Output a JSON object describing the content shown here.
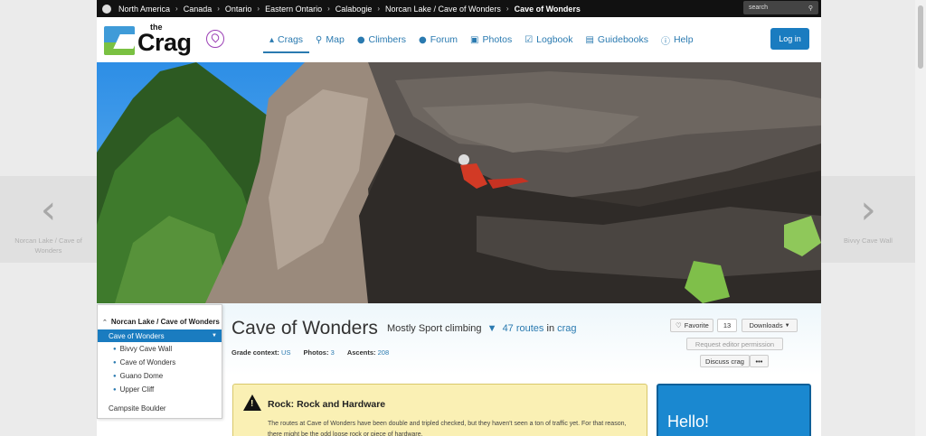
{
  "breadcrumb": {
    "items": [
      "North America",
      "Canada",
      "Ontario",
      "Eastern Ontario",
      "Calabogie",
      "Norcan Lake / Cave of Wonders"
    ],
    "current": "Cave of Wonders",
    "search_placeholder": "search"
  },
  "logo": {
    "small": "the",
    "name": "Crag"
  },
  "nav": {
    "items": [
      {
        "label": "Crags",
        "icon": "crags-icon"
      },
      {
        "label": "Map",
        "icon": "map-icon"
      },
      {
        "label": "Climbers",
        "icon": "climber-icon"
      },
      {
        "label": "Forum",
        "icon": "forum-icon"
      },
      {
        "label": "Photos",
        "icon": "camera-icon"
      },
      {
        "label": "Logbook",
        "icon": "logbook-icon"
      },
      {
        "label": "Guidebooks",
        "icon": "book-icon"
      },
      {
        "label": "Help",
        "icon": "info-icon"
      }
    ],
    "login_label": "Log in"
  },
  "side": {
    "prev_label": "Norcan Lake / Cave of Wonders",
    "next_label": "Bivvy Cave Wall"
  },
  "tree": {
    "parent": "Norcan Lake / Cave of Wonders",
    "current": "Cave of Wonders",
    "children": [
      "Bivvy Cave Wall",
      "Cave of Wonders",
      "Guano Dome",
      "Upper Cliff"
    ],
    "other": "Campsite Boulder"
  },
  "crag": {
    "title": "Cave of Wonders",
    "subtitle_type": "Mostly Sport climbing",
    "routes_link": "47 routes",
    "routes_suffix": "in",
    "crag_link": "crag",
    "grade_context_label": "Grade context:",
    "grade_context": "US",
    "photos_label": "Photos:",
    "photos": "3",
    "ascents_label": "Ascents:",
    "ascents": "208"
  },
  "actions": {
    "favorite": "Favorite",
    "favorite_count": "13",
    "downloads": "Downloads",
    "request_editor": "Request editor permission",
    "discuss": "Discuss crag",
    "more": "•••"
  },
  "alert": {
    "heading": "Rock: Rock and Hardware",
    "text": "The routes at Cave of Wonders have been double and tripled checked, but they haven't seen a ton of traffic yet. For that reason, there might be the odd loose rock or piece of hardware."
  },
  "promo": {
    "text": "Hello!"
  },
  "colors": {
    "accent": "#1a7cc0",
    "link": "#2a7ab0",
    "alert_bg": "#faf0b4"
  }
}
